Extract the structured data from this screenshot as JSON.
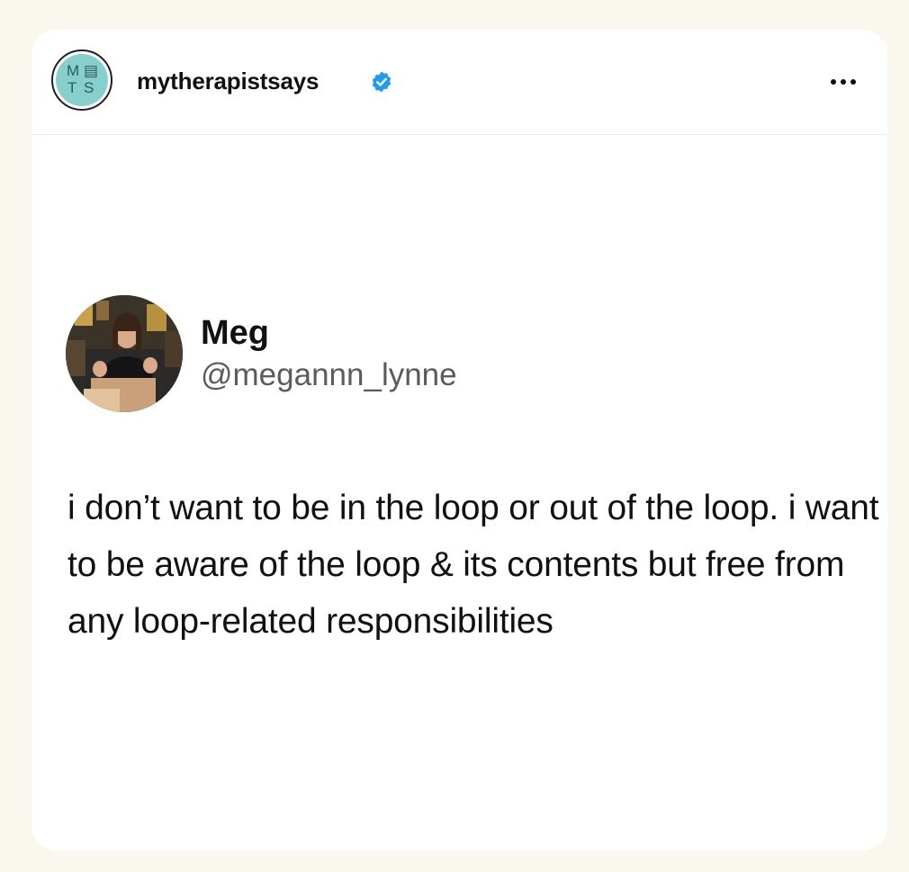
{
  "post": {
    "account_name": "mytherapistsays",
    "account_avatar_letters": [
      "M",
      "▤",
      "T",
      "S"
    ],
    "verified_icon": "verified-badge-icon",
    "more_icon": "more-horizontal-icon",
    "accent_color": "#1d9bf0",
    "avatar_color": "#86cfcd"
  },
  "tweet": {
    "author_name": "Meg",
    "author_handle": "@megannn_lynne",
    "text": "i don’t want to be in the loop or out of the loop. i want to be aware of the loop & its contents but free from any loop-related responsibilities"
  }
}
